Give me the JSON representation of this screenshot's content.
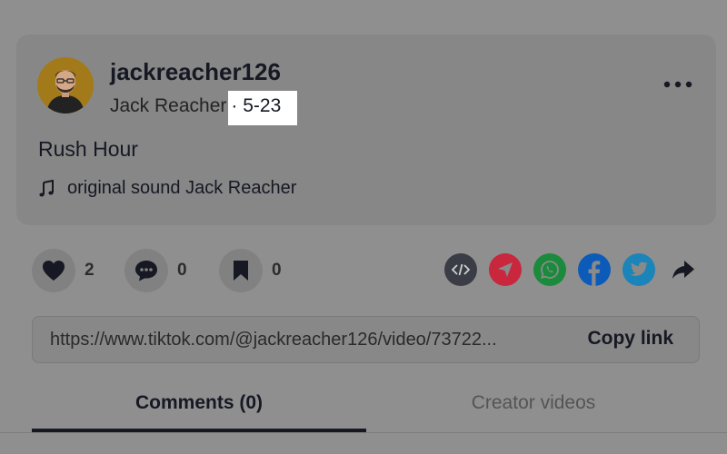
{
  "post": {
    "username": "jackreacher126",
    "display_name": "Jack Reacher",
    "separator": " · ",
    "date": "5-23",
    "caption": "Rush Hour",
    "sound": "original sound Jack Reacher"
  },
  "actions": {
    "likes": "2",
    "comments": "0",
    "saves": "0"
  },
  "share_icons": [
    "embed-icon",
    "send-icon",
    "whatsapp-icon",
    "facebook-icon",
    "twitter-icon",
    "share-arrow-icon"
  ],
  "colors": {
    "send": "#c8273e",
    "whatsapp": "#1b8a3c",
    "facebook": "#0c5bb8",
    "twitter": "#1b84b8",
    "embed": "#3a3d45",
    "overlay_bg": "#8f8f8f"
  },
  "link": {
    "url": "https://www.tiktok.com/@jackreacher126/video/73722...",
    "copy_label": "Copy link"
  },
  "tabs": [
    {
      "label": "Comments (0)",
      "active": true
    },
    {
      "label": "Creator videos",
      "active": false
    }
  ]
}
